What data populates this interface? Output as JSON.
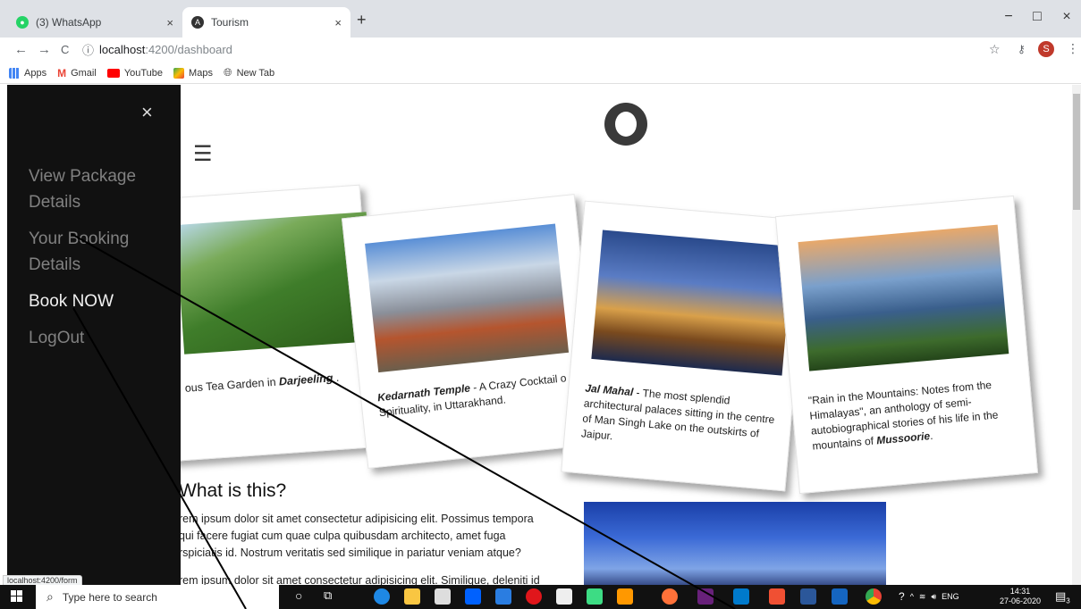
{
  "browser": {
    "tabs": [
      {
        "label": "(3) WhatsApp",
        "close": "×"
      },
      {
        "label": "Tourism",
        "close": "×"
      }
    ],
    "new_tab": "+",
    "window_controls": {
      "minimize": "−",
      "maximize": "□",
      "close": "×"
    },
    "nav": {
      "back": "←",
      "forward": "→",
      "reload": "C",
      "info": "ⓘ"
    },
    "url": {
      "host": "localhost",
      "path": ":4200/dashboard"
    },
    "profile_initial": "S",
    "bookmarks": [
      "Apps",
      "Gmail",
      "YouTube",
      "Maps",
      "New Tab"
    ]
  },
  "sidebar": {
    "close": "×",
    "items": [
      {
        "label": "View Package Details"
      },
      {
        "label": "Your Booking Details"
      },
      {
        "label": "Book NOW"
      },
      {
        "label": "LogOut"
      }
    ]
  },
  "page": {
    "menu_glyph": "☰",
    "cards": [
      {
        "caption_pre": "ous Tea Garden in ",
        "caption_em": "Darjeeling",
        "caption_post": " ."
      },
      {
        "caption_em": "Kedarnath Temple",
        "caption_post": " - A Crazy Cocktail o Spirituality, in Uttarakhand."
      },
      {
        "caption_em": "Jal Mahal",
        "caption_post": " - The most splendid architectural palaces sitting in the centre of Man Singh Lake on the outskirts of Jaipur."
      },
      {
        "caption_pre": "\"Rain in the Mountains: Notes from the Himalayas\", an anthology of semi-autobiographical stories of his life in the mountains of ",
        "caption_em": "Mussoorie",
        "caption_post": "."
      }
    ],
    "what_title": "What is this?",
    "paragraphs": [
      "rem ipsum dolor sit amet consectetur adipisicing elit. Possimus tempora",
      "qui facere fugiat cum quae culpa quibusdam architecto, amet fuga",
      "rspiciatis id. Nostrum veritatis sed similique in pariatur veniam atque?",
      "rem ipsum dolor sit amet consectetur adipisicing elit. Similique, deleniti id"
    ]
  },
  "status_url": "localhost:4200/form",
  "taskbar": {
    "search_placeholder": "Type here to search",
    "tray_lang": "ENG",
    "time": "14:31",
    "date": "27-06-2020",
    "notifications": "3"
  }
}
